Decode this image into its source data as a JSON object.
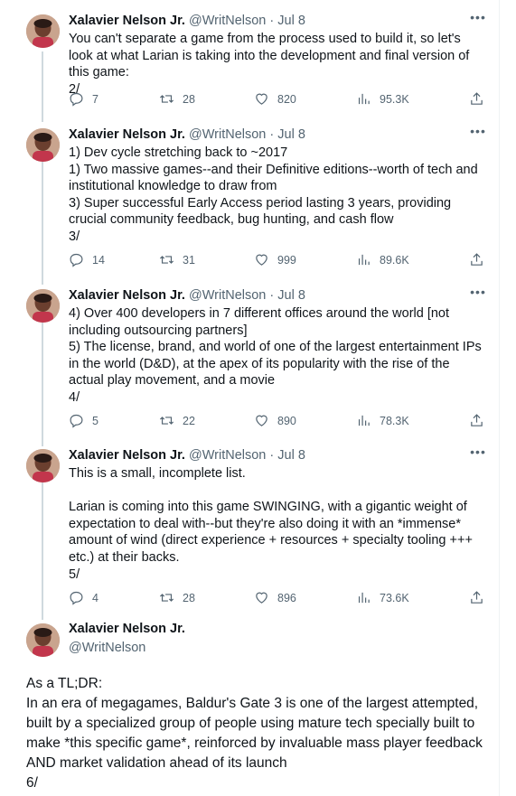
{
  "tweets": [
    {
      "name": "Xalavier Nelson Jr.",
      "handle": "@WritNelson",
      "dot": "·",
      "time": "Jul 8",
      "text": "You can't separate a game from the process used to build it, so let's look at what Larian is taking into the development and final version of this game:\n2/",
      "replies": "7",
      "retweets": "28",
      "likes": "820",
      "views": "95.3K"
    },
    {
      "name": "Xalavier Nelson Jr.",
      "handle": "@WritNelson",
      "dot": "·",
      "time": "Jul 8",
      "text": "1) Dev cycle stretching back to ~2017\n1) Two massive games--and their Definitive editions--worth of tech and institutional knowledge to draw from\n3) Super successful Early Access period lasting 3 years, providing crucial community feedback, bug hunting, and cash flow\n3/",
      "replies": "14",
      "retweets": "31",
      "likes": "999",
      "views": "89.6K"
    },
    {
      "name": "Xalavier Nelson Jr.",
      "handle": "@WritNelson",
      "dot": "·",
      "time": "Jul 8",
      "text": "4) Over 400 developers in 7 different offices around the world [not including outsourcing partners]\n5) The license, brand, and world of one of the largest entertainment IPs in the world (D&D), at the apex of its popularity with the rise of the actual play movement, and a movie\n4/",
      "replies": "5",
      "retweets": "22",
      "likes": "890",
      "views": "78.3K"
    },
    {
      "name": "Xalavier Nelson Jr.",
      "handle": "@WritNelson",
      "dot": "·",
      "time": "Jul 8",
      "text": "This is a small, incomplete list.\n\nLarian is coming into this game SWINGING, with a gigantic weight of expectation to deal with--but they're also doing it with an *immense* amount of wind (direct experience + resources + specialty tooling +++ etc.) at their backs.\n5/",
      "replies": "4",
      "retweets": "28",
      "likes": "896",
      "views": "73.6K"
    }
  ],
  "final_tweet": {
    "name": "Xalavier Nelson Jr.",
    "handle": "@WritNelson",
    "text": "As a TL;DR:\nIn an era of megagames, Baldur's Gate 3 is one of the largest attempted, built by a specialized group of people using mature tech specially built to make *this specific game*, reinforced by invaluable mass player feedback AND market validation ahead of its launch\n6/"
  },
  "icons": {
    "more": "more-icon",
    "reply": "reply-icon",
    "retweet": "retweet-icon",
    "like": "heart-icon",
    "views": "views-icon",
    "share": "share-icon"
  },
  "colors": {
    "text": "#0f1419",
    "secondary": "#536471",
    "thread_line": "#cfd9de",
    "background": "#ffffff"
  }
}
